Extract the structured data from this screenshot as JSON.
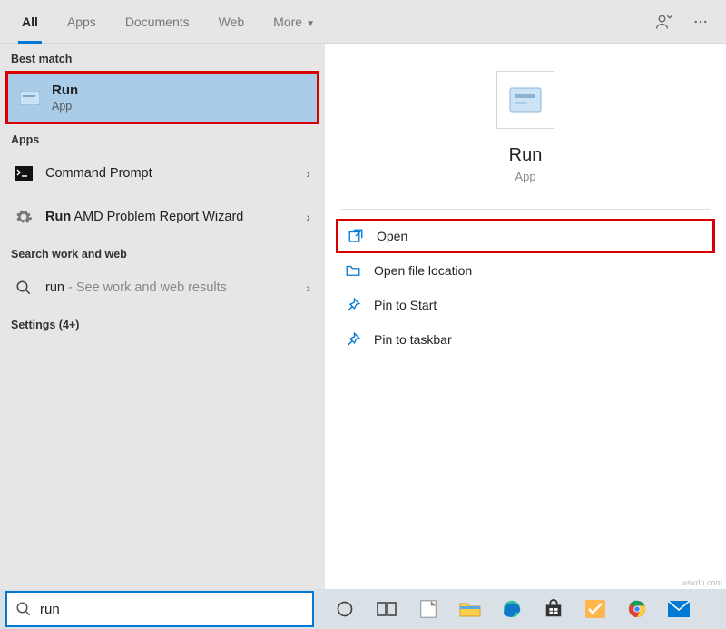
{
  "tabs": {
    "all": "All",
    "apps": "Apps",
    "documents": "Documents",
    "web": "Web",
    "more": "More"
  },
  "sections": {
    "best_match": "Best match",
    "apps": "Apps",
    "search_work_web": "Search work and web"
  },
  "best_match": {
    "title": "Run",
    "subtitle": "App"
  },
  "results": {
    "command_prompt": "Command Prompt",
    "run_bold": "Run",
    "run_rest": " AMD Problem Report Wizard",
    "run_web": "run",
    "run_web_suffix": " - See work and web results"
  },
  "settings_label": "Settings (4+)",
  "preview": {
    "title": "Run",
    "subtitle": "App"
  },
  "actions": {
    "open": "Open",
    "open_file_location": "Open file location",
    "pin_to_start": "Pin to Start",
    "pin_to_taskbar": "Pin to taskbar"
  },
  "search": {
    "value": "run"
  },
  "watermark": "wsxdn.com"
}
